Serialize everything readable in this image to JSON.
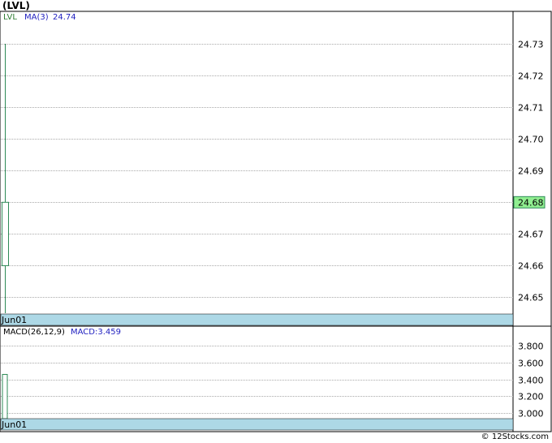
{
  "title": "(LVL)",
  "credit": "© 12Stocks.com",
  "colors": {
    "grid": "#aaaaaa",
    "axis_band": "#add8e6",
    "up_candle": "#2e8b57",
    "ma_text": "#1f1fbf",
    "ticker_text": "#2e7d32",
    "price_box": "#90ee90"
  },
  "chart_data": [
    {
      "type": "candlestick",
      "legend": {
        "ticker": "LVL",
        "ma_label": "MA(3)",
        "ma_value": "24.74"
      },
      "x_tick_labels": [
        "Jun01"
      ],
      "ylim": [
        24.645,
        24.74
      ],
      "y_ticks": [
        24.65,
        24.66,
        24.67,
        24.68,
        24.69,
        24.7,
        24.71,
        24.72,
        24.73
      ],
      "y_tick_labels": [
        "24.65",
        "24.66",
        "24.67",
        "24.68",
        "24.69",
        "24.70",
        "24.71",
        "24.72",
        "24.73"
      ],
      "last_price_label": "24.68",
      "last_price": 24.68,
      "candles": [
        {
          "date": "Jun01",
          "open": 24.66,
          "close": 24.68,
          "high": 24.73,
          "low": 24.645
        }
      ],
      "grid": true
    },
    {
      "type": "bar",
      "legend": {
        "label": "MACD(26,12,9)",
        "value_label": "MACD:3.459"
      },
      "x_tick_labels": [
        "Jun01"
      ],
      "ylim": [
        2.93,
        3.9
      ],
      "y_ticks": [
        3.0,
        3.2,
        3.4,
        3.6,
        3.8
      ],
      "y_tick_labels": [
        "3.000",
        "3.200",
        "3.400",
        "3.600",
        "3.800"
      ],
      "bars": [
        {
          "date": "Jun01",
          "value": 3.459
        }
      ],
      "grid": true
    }
  ]
}
